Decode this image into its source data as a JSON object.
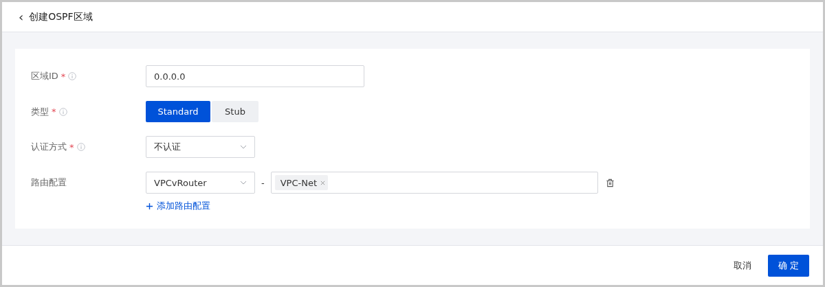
{
  "header": {
    "back_icon": "‹",
    "title": "创建OSPF区域"
  },
  "form": {
    "area_id": {
      "label": "区域ID",
      "required_mark": "*",
      "value": "0.0.0.0"
    },
    "type": {
      "label": "类型",
      "required_mark": "*",
      "options": [
        {
          "label": "Standard",
          "selected": true
        },
        {
          "label": "Stub",
          "selected": false
        }
      ]
    },
    "auth": {
      "label": "认证方式",
      "required_mark": "*",
      "value": "不认证"
    },
    "route": {
      "label": "路由配置",
      "router": "VPCvRouter",
      "separator": "-",
      "tags": [
        "VPC-Net"
      ],
      "add_link": "添加路由配置"
    }
  },
  "footer": {
    "buttons": [
      {
        "label": "取消",
        "kind": "secondary"
      },
      {
        "label": "确 定",
        "kind": "primary"
      }
    ]
  }
}
